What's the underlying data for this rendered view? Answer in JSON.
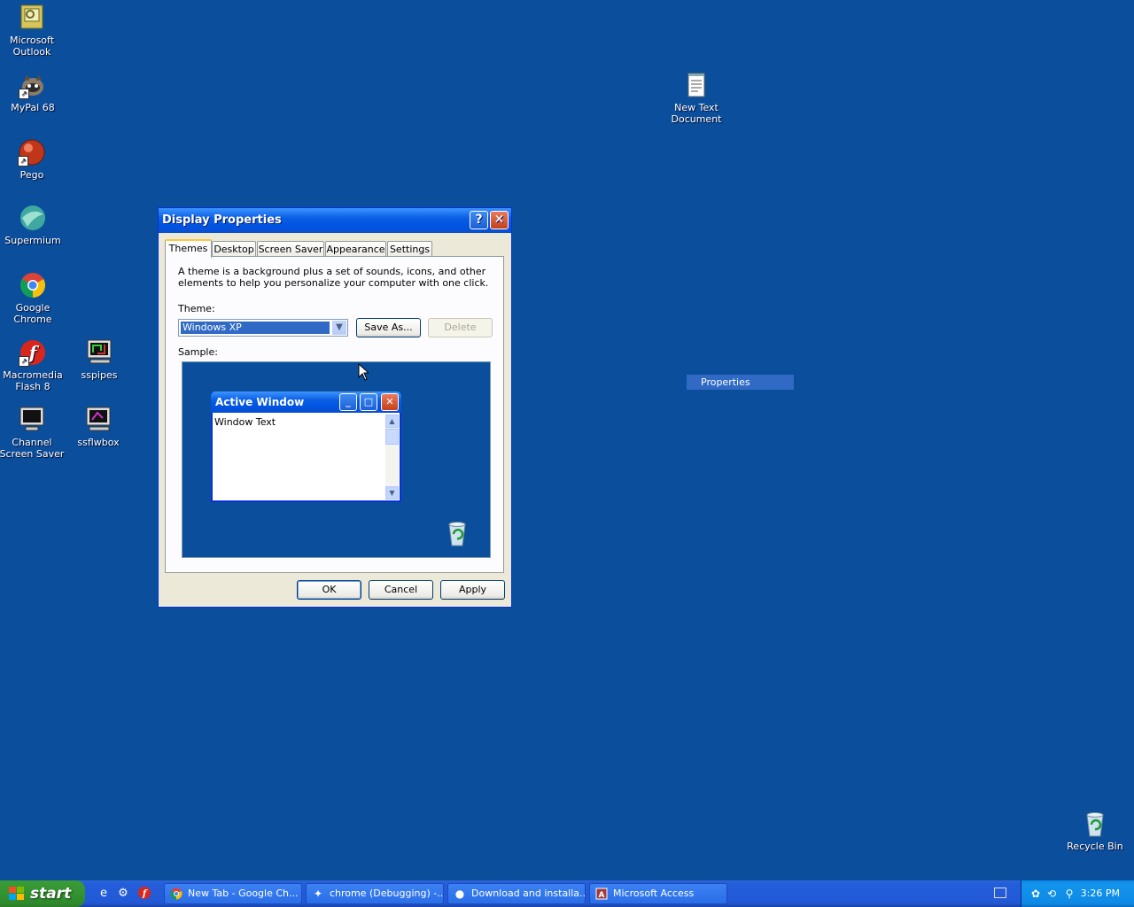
{
  "desktop": {
    "icons": [
      {
        "label": "Microsoft Outlook",
        "icon": "outlook-icon"
      },
      {
        "label": "MyPal 68",
        "icon": "mypal-icon"
      },
      {
        "label": "Pego",
        "icon": "pego-icon"
      },
      {
        "label": "Supermium",
        "icon": "supermium-icon"
      },
      {
        "label": "Google Chrome",
        "icon": "chrome-icon"
      },
      {
        "label": "Macromedia Flash 8",
        "icon": "flash-icon"
      },
      {
        "label": "Channel Screen Saver",
        "icon": "monitor-icon"
      },
      {
        "label": "sspipes",
        "icon": "monitor-icon"
      },
      {
        "label": "ssflwbox",
        "icon": "monitor-icon"
      },
      {
        "label": "New Text Document",
        "icon": "text-document-icon"
      },
      {
        "label": "Recycle Bin",
        "icon": "recycle-bin-icon"
      }
    ],
    "context_menu_item": "Properties"
  },
  "dialog": {
    "title": "Display Properties",
    "tabs": [
      "Themes",
      "Desktop",
      "Screen Saver",
      "Appearance",
      "Settings"
    ],
    "active_tab": "Themes",
    "description": "A theme is a background plus a set of sounds, icons, and other elements to help you personalize your computer with one click.",
    "theme_label": "Theme:",
    "theme_value": "Windows XP",
    "save_as": "Save As...",
    "delete": "Delete",
    "sample_label": "Sample:",
    "sample": {
      "window_title": "Active Window",
      "window_text": "Window Text"
    },
    "ok": "OK",
    "cancel": "Cancel",
    "apply": "Apply"
  },
  "taskbar": {
    "start": "start",
    "tasks": [
      {
        "label": "New Tab - Google Ch...",
        "icon": "chrome-icon"
      },
      {
        "label": "chrome (Debugging) -...",
        "icon": "debugger-icon"
      },
      {
        "label": "Download and installa...",
        "icon": "mypal-icon"
      },
      {
        "label": "Microsoft Access",
        "icon": "access-icon"
      }
    ],
    "clock": "3:26 PM"
  },
  "colors": {
    "desktop": "#0b4f9c",
    "xp_blue": "#0054e3",
    "start_green": "#379a35",
    "selection": "#316ac5"
  }
}
